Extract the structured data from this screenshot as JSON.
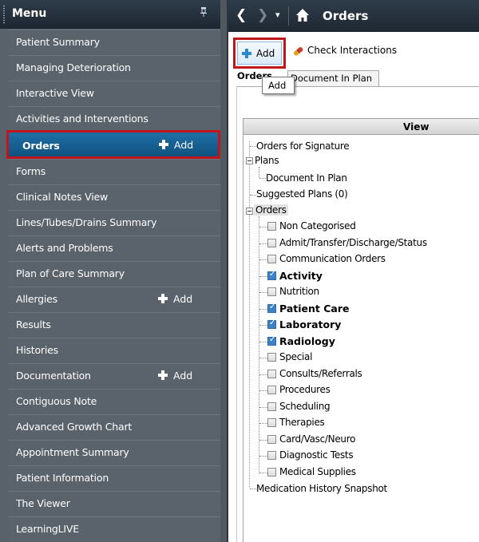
{
  "menu": {
    "title": "Menu",
    "pin_glyph": "ᵖ",
    "items": [
      {
        "label": "Patient Summary"
      },
      {
        "label": "Managing Deterioration"
      },
      {
        "label": "Interactive View"
      },
      {
        "label": "Activities and Interventions"
      },
      {
        "label": "Orders",
        "add": "Add",
        "selected": true
      },
      {
        "label": "Forms"
      },
      {
        "label": "Clinical Notes View"
      },
      {
        "label": "Lines/Tubes/Drains Summary"
      },
      {
        "label": "Alerts and Problems"
      },
      {
        "label": "Plan of Care Summary"
      },
      {
        "label": "Allergies",
        "add": "Add"
      },
      {
        "label": "Results"
      },
      {
        "label": "Histories"
      },
      {
        "label": "Documentation",
        "add": "Add"
      },
      {
        "label": "Contiguous Note"
      },
      {
        "label": "Advanced Growth Chart"
      },
      {
        "label": "Appointment Summary"
      },
      {
        "label": "Patient Information"
      },
      {
        "label": "The Viewer"
      },
      {
        "label": "LearningLIVE"
      }
    ]
  },
  "topbar": {
    "back_glyph": "❮",
    "forward_glyph": "❯",
    "dropdown_glyph": "▾",
    "title": "Orders"
  },
  "toolbar": {
    "add_label": "Add",
    "check_label": "Check Interactions",
    "tooltip": "Add"
  },
  "tabs": [
    {
      "label": "Orders",
      "active": true
    },
    {
      "label": "Document In Plan",
      "active": false
    }
  ],
  "view": {
    "header": "View",
    "tree": {
      "orders_for_signature": "Orders for Signature",
      "plans": "Plans",
      "document_in_plan": "Document In Plan",
      "suggested_plans": "Suggested Plans (0)",
      "orders": "Orders",
      "categories": [
        {
          "label": "Non Categorised",
          "checked": false
        },
        {
          "label": "Admit/Transfer/Discharge/Status",
          "checked": false
        },
        {
          "label": "Communication Orders",
          "checked": false
        },
        {
          "label": "Activity",
          "checked": true
        },
        {
          "label": "Nutrition",
          "checked": false
        },
        {
          "label": "Patient Care",
          "checked": true
        },
        {
          "label": "Laboratory",
          "checked": true
        },
        {
          "label": "Radiology",
          "checked": true
        },
        {
          "label": "Special",
          "checked": false
        },
        {
          "label": "Consults/Referrals",
          "checked": false
        },
        {
          "label": "Procedures",
          "checked": false
        },
        {
          "label": "Scheduling",
          "checked": false
        },
        {
          "label": "Therapies",
          "checked": false
        },
        {
          "label": "Card/Vasc/Neuro",
          "checked": false
        },
        {
          "label": "Diagnostic Tests",
          "checked": false
        },
        {
          "label": "Medical Supplies",
          "checked": false
        }
      ],
      "medication_history": "Medication History Snapshot"
    }
  },
  "colors": {
    "menu_bg": "#59616a",
    "header_bg": "#1e2833",
    "selected_bg": "#1a669c",
    "highlight_border": "#c0151a",
    "checkbox_on": "#3d82c9"
  }
}
